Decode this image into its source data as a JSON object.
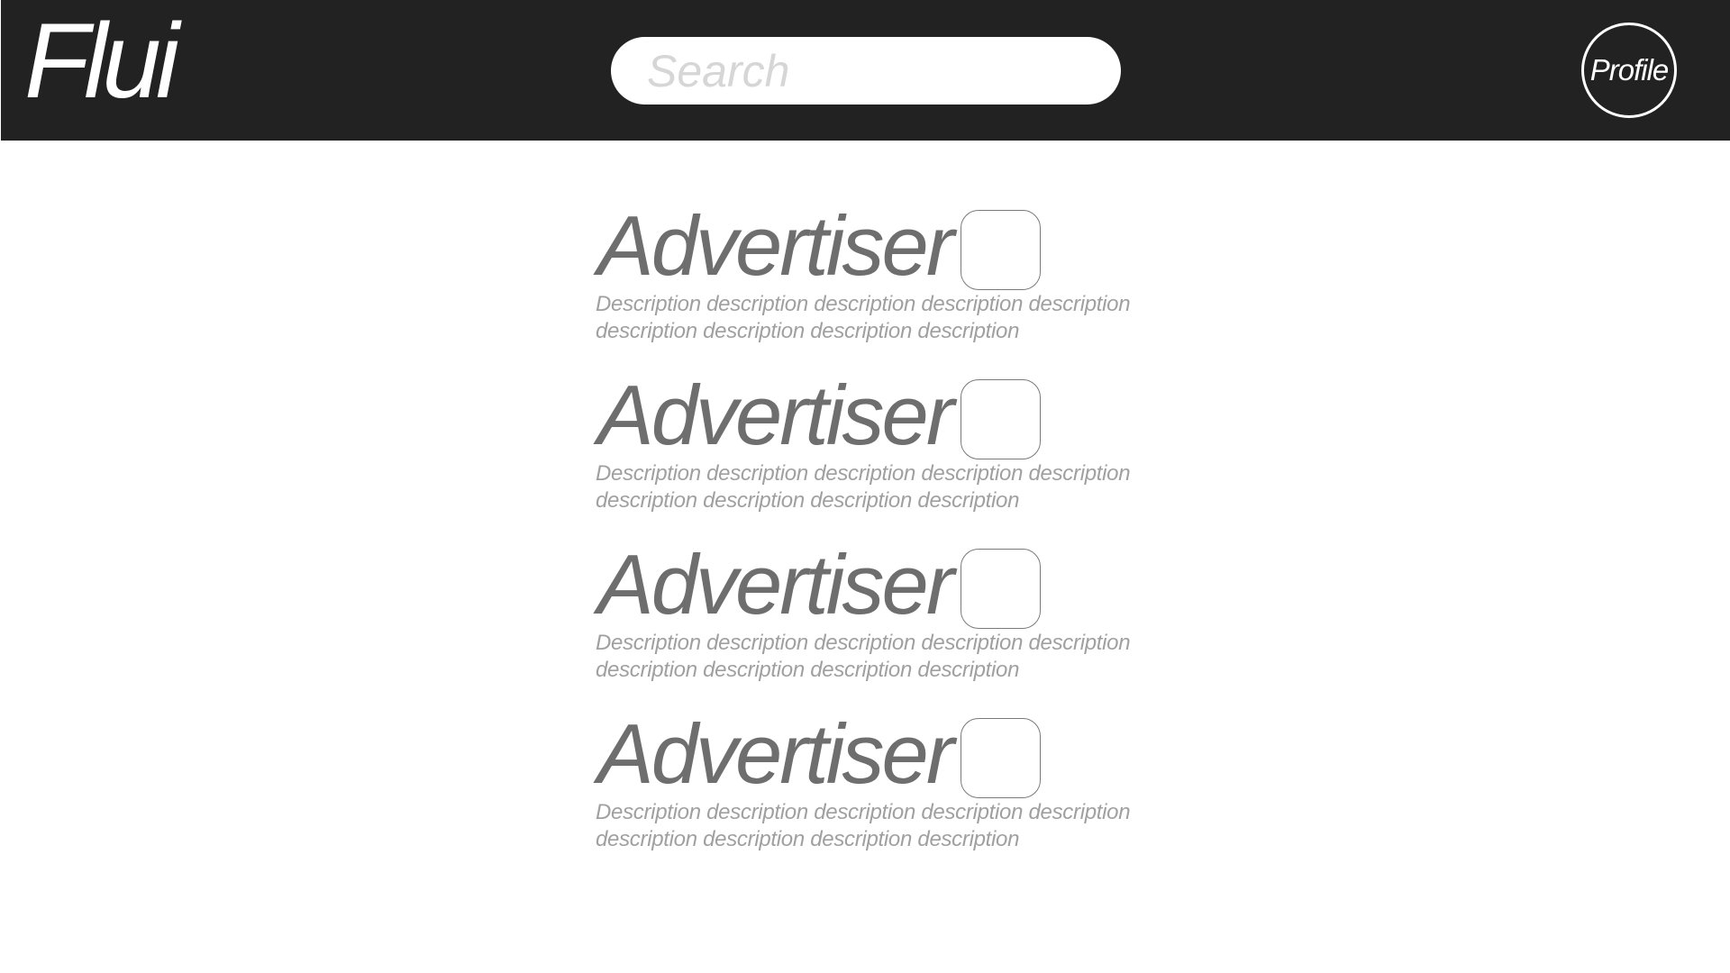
{
  "header": {
    "logo": "Flui",
    "search_placeholder": "Search",
    "profile_label": "Profile"
  },
  "ads": [
    {
      "title": "Advertiser",
      "description": "Description description description description description description description description description"
    },
    {
      "title": "Advertiser",
      "description": "Description description description description description description description description description"
    },
    {
      "title": "Advertiser",
      "description": "Description description description description description description description description description"
    },
    {
      "title": "Advertiser",
      "description": "Description description description description description description description description description"
    }
  ],
  "colors": {
    "header_bg": "#222222",
    "title_text": "#6e6e6e",
    "description_text": "#a0a0a0"
  }
}
